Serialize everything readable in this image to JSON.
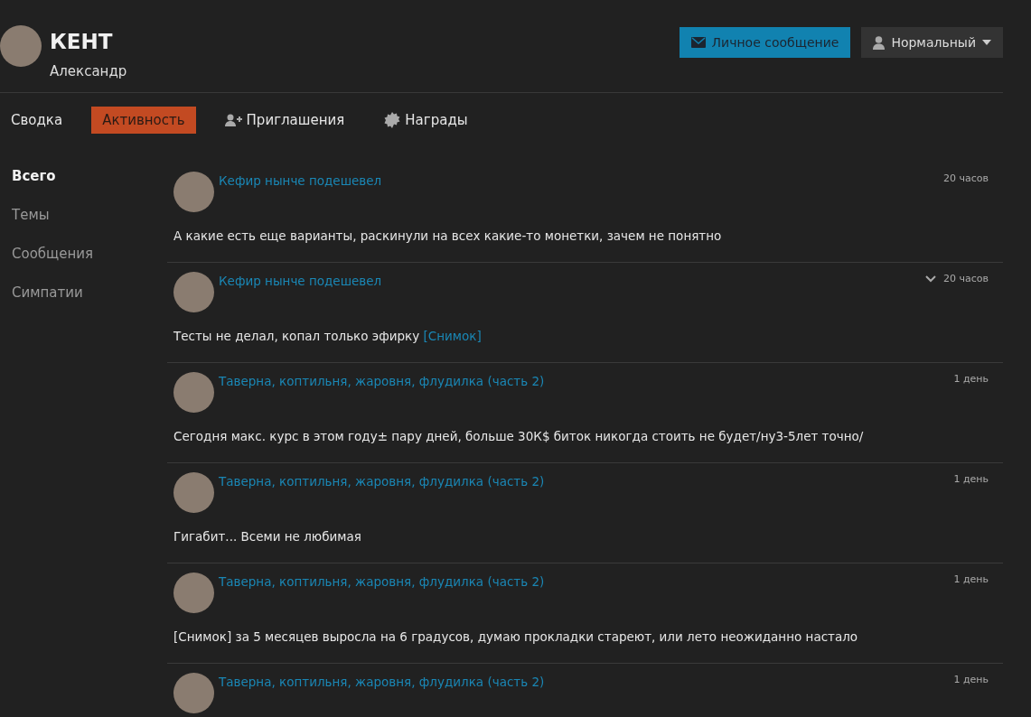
{
  "profile": {
    "name": "КЕНТ",
    "subtitle": "Александр"
  },
  "actions": [
    {
      "kind": "message",
      "label": "Личное сообщение"
    },
    {
      "kind": "dropdown",
      "label": "Нормальный"
    }
  ],
  "tabs": [
    {
      "label": "Сводка",
      "kind": "plain",
      "selected": false
    },
    {
      "label": "Активность",
      "kind": "plain",
      "selected": true
    },
    {
      "label": "Приглашения",
      "kind": "invite",
      "selected": false
    },
    {
      "label": "Награды",
      "kind": "awards",
      "selected": false
    }
  ],
  "sidebar": {
    "items": [
      {
        "label": "Всего",
        "selected": true
      },
      {
        "label": "Темы",
        "selected": false
      },
      {
        "label": "Сообщения",
        "selected": false
      },
      {
        "label": "Симпатии",
        "selected": false
      }
    ]
  },
  "feed": [
    {
      "thread": "Кефир нынче подешевел",
      "time": "20 часов",
      "menu": false,
      "body": [
        {
          "kind": "plain",
          "text": "А какие есть еще варианты, раскинули на всех какие-то монетки, зачем не понятно"
        }
      ]
    },
    {
      "thread": "Кефир нынче подешевел",
      "time": "20 часов",
      "menu": true,
      "body": [
        {
          "kind": "plain",
          "text": "Тесты не делал, копал только эфирку "
        },
        {
          "kind": "link",
          "text": "[Снимок]"
        }
      ]
    },
    {
      "thread": "Таверна, коптильня, жаровня, флудилка (часть 2)",
      "time": "1 день",
      "menu": false,
      "body": [
        {
          "kind": "plain",
          "text": "Сегодня макс. курс в этом году± пару дней, больше 30К$ биток никогда стоить не будет/ну3-5лет точно/"
        }
      ]
    },
    {
      "thread": "Таверна, коптильня, жаровня, флудилка (часть 2)",
      "time": "1 день",
      "menu": false,
      "body": [
        {
          "kind": "plain",
          "text": "Гигабит... Всеми не любимая"
        }
      ]
    },
    {
      "thread": "Таверна, коптильня, жаровня, флудилка (часть 2)",
      "time": "1 день",
      "menu": false,
      "body": [
        {
          "kind": "plain",
          "text": "[Снимок] за 5 месяцев выросла на 6 градусов, думаю прокладки стареют, или лето неожиданно настало"
        }
      ]
    },
    {
      "thread": "Таверна, коптильня, жаровня, флудилка (часть 2)",
      "time": "1 день",
      "menu": false
    }
  ]
}
